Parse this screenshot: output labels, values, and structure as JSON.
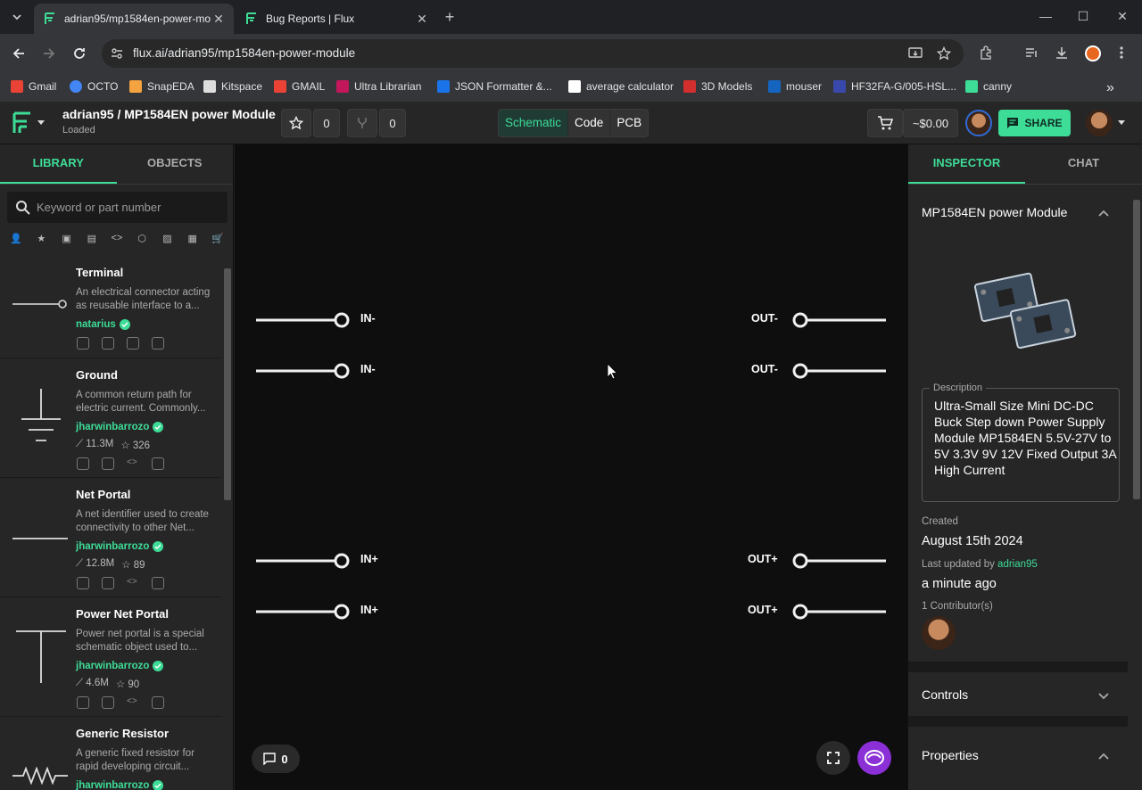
{
  "browser": {
    "tabs": [
      {
        "title": "adrian95/mp1584en-power-mo",
        "active": true
      },
      {
        "title": "Bug Reports | Flux",
        "active": false
      }
    ],
    "url": "flux.ai/adrian95/mp1584en-power-module",
    "bookmarks": [
      {
        "label": "Gmail",
        "color": "#ea4335"
      },
      {
        "label": "OCTO",
        "color": "#4285f4"
      },
      {
        "label": "SnapEDA",
        "color": "#f4a340"
      },
      {
        "label": "Kitspace",
        "color": "#dddddd"
      },
      {
        "label": "GMAIL",
        "color": "#ea4335"
      },
      {
        "label": "Ultra Librarian",
        "color": "#c2185b"
      },
      {
        "label": "JSON Formatter &...",
        "color": "#1a73e8"
      },
      {
        "label": "average calculator",
        "color": "#ffffff"
      },
      {
        "label": "3D Models",
        "color": "#d32f2f"
      },
      {
        "label": "mouser",
        "color": "#1565c0"
      },
      {
        "label": "HF32FA-G/005-HSL...",
        "color": "#3949ab"
      },
      {
        "label": "canny",
        "color": "#3ddc97"
      }
    ]
  },
  "header": {
    "project_title": "adrian95 / MP1584EN power Module",
    "status": "Loaded",
    "stars": "0",
    "forks": "0",
    "views": [
      "Schematic",
      "Code",
      "PCB"
    ],
    "active_view": "Schematic",
    "cart_total": "~$0.00",
    "share_label": "SHARE"
  },
  "library": {
    "tabs": [
      "LIBRARY",
      "OBJECTS"
    ],
    "search_placeholder": "Keyword or part number",
    "items": [
      {
        "title": "Terminal",
        "desc": "An electrical connector acting as reusable interface to a...",
        "author": "natarius",
        "uses": "",
        "stars": ""
      },
      {
        "title": "Ground",
        "desc": "A common return path for electric current. Commonly...",
        "author": "jharwinbarrozo",
        "uses": "11.3M",
        "stars": "326"
      },
      {
        "title": "Net Portal",
        "desc": "A net identifier used to create connectivity to other Net...",
        "author": "jharwinbarrozo",
        "uses": "12.8M",
        "stars": "89"
      },
      {
        "title": "Power Net Portal",
        "desc": "Power net portal is a special schematic object used to...",
        "author": "jharwinbarrozo",
        "uses": "4.6M",
        "stars": "90"
      },
      {
        "title": "Generic Resistor",
        "desc": "A generic fixed resistor for rapid developing circuit...",
        "author": "jharwinbarrozo",
        "uses": "",
        "stars": ""
      }
    ]
  },
  "canvas": {
    "left_pins": [
      "IN-",
      "IN-",
      "IN+",
      "IN+"
    ],
    "right_pins": [
      "OUT-",
      "OUT-",
      "OUT+",
      "OUT+"
    ],
    "comment_count": "0"
  },
  "inspector": {
    "tabs": [
      "INSPECTOR",
      "CHAT"
    ],
    "module_title": "MP1584EN power Module",
    "description_label": "Description",
    "description": "Ultra-Small Size Mini DC-DC Buck Step down Power Supply Module MP1584EN 5.5V-27V to 5V 3.3V 9V 12V Fixed Output 3A High Current",
    "created_label": "Created",
    "created": "August 15th 2024",
    "updated_label": "Last updated by",
    "updated_by": "adrian95",
    "updated": "a minute ago",
    "contributors_label": "1 Contributor(s)",
    "controls_label": "Controls",
    "properties_label": "Properties"
  },
  "colors": {
    "accent": "#3ddc97",
    "copilot": "#8b2fd6"
  }
}
